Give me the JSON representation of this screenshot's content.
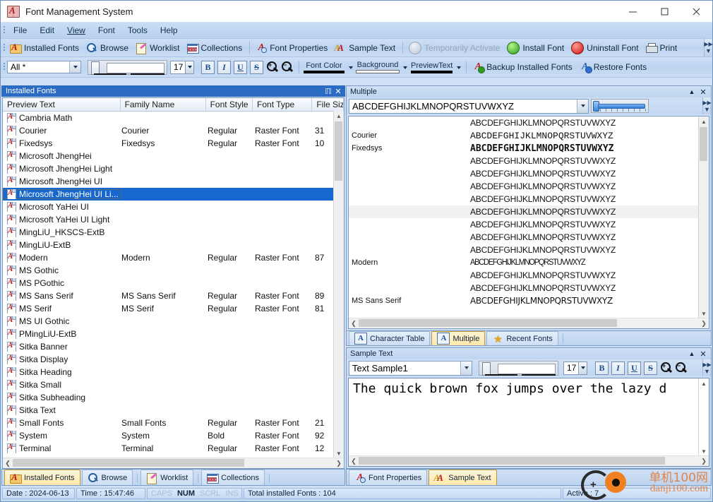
{
  "window": {
    "title": "Font Management System",
    "icon": "font-book-icon",
    "controls": {
      "minimize": "—",
      "maximize": "□",
      "close": "✕"
    }
  },
  "menu": {
    "items": [
      "File",
      "Edit",
      "View",
      "Font",
      "Tools",
      "Help"
    ]
  },
  "toolbar1": {
    "items": [
      {
        "label": "Installed Fonts",
        "icon": "installed-fonts-icon",
        "disabled": false
      },
      {
        "label": "Browse",
        "icon": "magnifier-icon",
        "disabled": false
      },
      {
        "label": "Worklist",
        "icon": "worklist-icon",
        "disabled": false
      },
      {
        "label": "Collections",
        "icon": "collections-icon",
        "disabled": false
      },
      {
        "label": "Font Properties",
        "icon": "font-properties-icon",
        "disabled": false
      },
      {
        "label": "Sample Text",
        "icon": "sample-text-icon",
        "disabled": false
      },
      {
        "label": "Temporarily Activate",
        "icon": "grey-circle-icon",
        "disabled": true
      },
      {
        "label": "Install Font",
        "icon": "green-circle-icon",
        "disabled": false
      },
      {
        "label": "Uninstall Font",
        "icon": "red-circle-icon",
        "disabled": false
      },
      {
        "label": "Print",
        "icon": "printer-icon",
        "disabled": false
      }
    ]
  },
  "toolbar2": {
    "filter": {
      "value": "All *",
      "placeholder": "All *"
    },
    "size": {
      "value": "17"
    },
    "format_buttons": [
      {
        "label": "B",
        "name": "bold-button"
      },
      {
        "label": "I",
        "name": "italic-button"
      },
      {
        "label": "U",
        "name": "underline-button"
      },
      {
        "label": "S",
        "name": "strikethrough-button"
      }
    ],
    "zoom_in": "+",
    "zoom_out": "−",
    "font_color": {
      "label": "Font Color",
      "color": "#000000"
    },
    "background": {
      "label": "Background",
      "color": "#ffffff"
    },
    "preview_text": {
      "label": "PreviewText",
      "color": "#000000"
    },
    "backup_label": "Backup Installed Fonts",
    "restore_label": "Restore Fonts"
  },
  "left_panel": {
    "title": "Installed Fonts",
    "pin_icon": "pin-icon",
    "close_icon": "close-icon",
    "columns": [
      "Preview Text",
      "Family Name",
      "Font Style",
      "Font Type",
      "File Siz"
    ],
    "rows": [
      {
        "preview": "Cambria Math",
        "family": "",
        "style": "",
        "type": "",
        "size": "",
        "selected": false
      },
      {
        "preview": "Courier",
        "family": "Courier",
        "style": "Regular",
        "type": "Raster Font",
        "size": "31",
        "selected": false
      },
      {
        "preview": "Fixedsys",
        "family": "Fixedsys",
        "style": "Regular",
        "type": "Raster Font",
        "size": "10",
        "selected": false
      },
      {
        "preview": "Microsoft JhengHei",
        "family": "",
        "style": "",
        "type": "",
        "size": "",
        "selected": false
      },
      {
        "preview": "Microsoft JhengHei Light",
        "family": "",
        "style": "",
        "type": "",
        "size": "",
        "selected": false
      },
      {
        "preview": "Microsoft JhengHei UI",
        "family": "",
        "style": "",
        "type": "",
        "size": "",
        "selected": false
      },
      {
        "preview": "Microsoft JhengHei UI Li...",
        "family": "",
        "style": "",
        "type": "",
        "size": "",
        "selected": true
      },
      {
        "preview": "Microsoft YaHei UI",
        "family": "",
        "style": "",
        "type": "",
        "size": "",
        "selected": false
      },
      {
        "preview": "Microsoft YaHei UI Light",
        "family": "",
        "style": "",
        "type": "",
        "size": "",
        "selected": false
      },
      {
        "preview": "MingLiU_HKSCS-ExtB",
        "family": "",
        "style": "",
        "type": "",
        "size": "",
        "selected": false
      },
      {
        "preview": "MingLiU-ExtB",
        "family": "",
        "style": "",
        "type": "",
        "size": "",
        "selected": false
      },
      {
        "preview": "Modern",
        "family": "Modern",
        "style": "Regular",
        "type": "Raster Font",
        "size": "87",
        "selected": false
      },
      {
        "preview": "MS Gothic",
        "family": "",
        "style": "",
        "type": "",
        "size": "",
        "selected": false
      },
      {
        "preview": "MS PGothic",
        "family": "",
        "style": "",
        "type": "",
        "size": "",
        "selected": false
      },
      {
        "preview": "MS Sans Serif",
        "family": "MS Sans Serif",
        "style": "Regular",
        "type": "Raster Font",
        "size": "89",
        "selected": false
      },
      {
        "preview": "MS Serif",
        "family": "MS Serif",
        "style": "Regular",
        "type": "Raster Font",
        "size": "81",
        "selected": false
      },
      {
        "preview": "MS UI Gothic",
        "family": "",
        "style": "",
        "type": "",
        "size": "",
        "selected": false
      },
      {
        "preview": "PMingLiU-ExtB",
        "family": "",
        "style": "",
        "type": "",
        "size": "",
        "selected": false
      },
      {
        "preview": "Sitka Banner",
        "family": "",
        "style": "",
        "type": "",
        "size": "",
        "selected": false
      },
      {
        "preview": "Sitka Display",
        "family": "",
        "style": "",
        "type": "",
        "size": "",
        "selected": false
      },
      {
        "preview": "Sitka Heading",
        "family": "",
        "style": "",
        "type": "",
        "size": "",
        "selected": false
      },
      {
        "preview": "Sitka Small",
        "family": "",
        "style": "",
        "type": "",
        "size": "",
        "selected": false
      },
      {
        "preview": "Sitka Subheading",
        "family": "",
        "style": "",
        "type": "",
        "size": "",
        "selected": false
      },
      {
        "preview": "Sitka Text",
        "family": "",
        "style": "",
        "type": "",
        "size": "",
        "selected": false
      },
      {
        "preview": "Small Fonts",
        "family": "Small Fonts",
        "style": "Regular",
        "type": "Raster Font",
        "size": "21",
        "selected": false
      },
      {
        "preview": "System",
        "family": "System",
        "style": "Bold",
        "type": "Raster Font",
        "size": "92",
        "selected": false
      },
      {
        "preview": "Terminal",
        "family": "Terminal",
        "style": "Regular",
        "type": "Raster Font",
        "size": "12",
        "selected": false
      }
    ]
  },
  "multiple_panel": {
    "title": "Multiple",
    "collapse_icon": "chevron-up-icon",
    "close_icon": "close-icon",
    "preview_value": "ABCDEFGHIJKLMNOPQRSTUVWXYZ",
    "rows": [
      {
        "name": "",
        "sample": "ABCDEFGHIJKLMNOPQRSTUVWXYZ",
        "style": "plain"
      },
      {
        "name": "Courier",
        "sample": "ABCDEFGHIJKLMNOPQRSTUVWXYZ",
        "style": "courier"
      },
      {
        "name": "Fixedsys",
        "sample": "ABCDEFGHIJKLMNOPQRSTUVWXYZ",
        "style": "fixedsys"
      },
      {
        "name": "",
        "sample": "ABCDEFGHIJKLMNOPQRSTUVWXYZ",
        "style": "plain"
      },
      {
        "name": "",
        "sample": "ABCDEFGHIJKLMNOPQRSTUVWXYZ",
        "style": "plain"
      },
      {
        "name": "",
        "sample": "ABCDEFGHIJKLMNOPQRSTUVWXYZ",
        "style": "plain"
      },
      {
        "name": "",
        "sample": "ABCDEFGHIJKLMNOPQRSTUVWXYZ",
        "style": "plain"
      },
      {
        "name": "",
        "sample": "ABCDEFGHIJKLMNOPQRSTUVWXYZ",
        "style": "plain"
      },
      {
        "name": "",
        "sample": "ABCDEFGHIJKLMNOPQRSTUVWXYZ",
        "style": "plain"
      },
      {
        "name": "",
        "sample": "ABCDEFGHIJKLMNOPQRSTUVWXYZ",
        "style": "plain"
      },
      {
        "name": "",
        "sample": "ABCDEFGHIJKLMNOPQRSTUVWXYZ",
        "style": "plain"
      },
      {
        "name": "Modern",
        "sample": "ABCDEFGHIJKLMNOPQRSTUVWXYZ",
        "style": "modern"
      },
      {
        "name": "",
        "sample": "ABCDEFGHIJKLMNOPQRSTUVWXYZ",
        "style": "plain"
      },
      {
        "name": "",
        "sample": "ABCDEFGHIJKLMNOPQRSTUVWXYZ",
        "style": "plain"
      },
      {
        "name": "MS Sans Serif",
        "sample": "ABCDEFGHIJKLMNOPQRSTUVWXYZ",
        "style": "sans"
      }
    ]
  },
  "preview_tabs": {
    "items": [
      {
        "label": "Character Table",
        "icon": "char-table-icon",
        "active": false
      },
      {
        "label": "Multiple",
        "icon": "multiple-icon",
        "active": true
      },
      {
        "label": "Recent Fonts",
        "icon": "star-icon",
        "active": false
      }
    ]
  },
  "sample_panel": {
    "title": "Sample Text",
    "collapse_icon": "chevron-up-icon",
    "close_icon": "close-icon",
    "sample_select": {
      "value": "Text Sample1"
    },
    "size": {
      "value": "17"
    },
    "format_buttons": [
      {
        "label": "B",
        "name": "bold-button"
      },
      {
        "label": "I",
        "name": "italic-button"
      },
      {
        "label": "U",
        "name": "underline-button"
      },
      {
        "label": "S",
        "name": "strikethrough-button"
      }
    ],
    "text": "The quick brown fox jumps over the lazy d"
  },
  "bottom_tabs_left": {
    "items": [
      {
        "label": "Installed Fonts",
        "icon": "installed-fonts-icon",
        "active": true
      },
      {
        "label": "Browse",
        "icon": "magnifier-icon",
        "active": false
      },
      {
        "label": "Worklist",
        "icon": "worklist-icon",
        "active": false
      },
      {
        "label": "Collections",
        "icon": "collections-icon",
        "active": false
      }
    ]
  },
  "bottom_tabs_right": {
    "items": [
      {
        "label": "Font Properties",
        "icon": "font-properties-icon",
        "active": false
      },
      {
        "label": "Sample Text",
        "icon": "sample-text-icon",
        "active": true
      }
    ]
  },
  "statusbar": {
    "date": "Date : 2024-06-13",
    "time": "Time : 15:47:46",
    "flags": [
      {
        "label": "CAPS",
        "on": false
      },
      {
        "label": "NUM",
        "on": true
      },
      {
        "label": "SCRL",
        "on": false
      },
      {
        "label": "INS",
        "on": false
      }
    ],
    "total": "Total installed Fonts : 104",
    "active": "Active : 7"
  },
  "watermark": {
    "line1": "单机100网",
    "line2": "danji100.com"
  }
}
